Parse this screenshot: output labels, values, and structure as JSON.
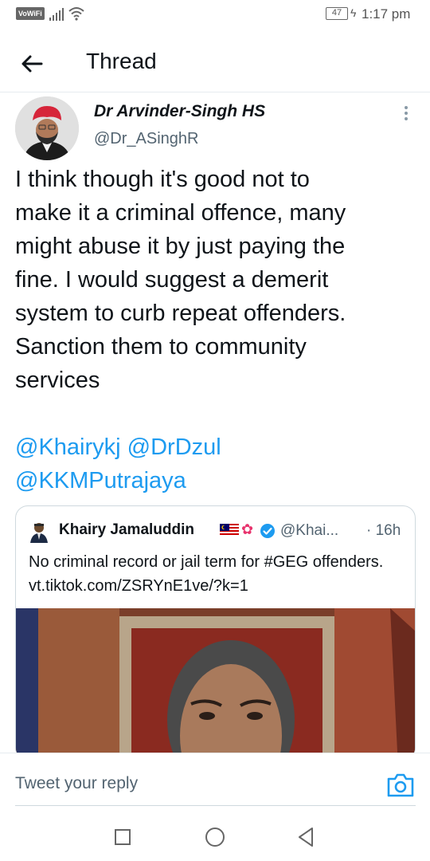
{
  "status_bar": {
    "vowifi": "VoWiFi",
    "battery": "47",
    "time": "1:17 pm"
  },
  "header": {
    "back_icon": "arrow-left-icon",
    "title": "Thread"
  },
  "tweet": {
    "author_name": "Dr Arvinder-Singh HS",
    "author_handle": "@Dr_ASinghR",
    "body": "I think though it's good not to\nmake it a criminal offence, many\nmight abuse it by just paying the\nfine. I would suggest a demerit\nsystem to curb repeat offenders.\nSanction them to community\nservices",
    "mentions": [
      "@Khairykj",
      "@DrDzul",
      "@KKMPutrajaya"
    ]
  },
  "quote": {
    "name": "Khairy Jamaluddin",
    "handle": "@Khai...",
    "time": "· 16h",
    "text": "No criminal record or jail term for #GEG offenders. vt.tiktok.com/ZSRYnE1ve/?k=1"
  },
  "reply": {
    "placeholder": "Tweet your reply"
  },
  "colors": {
    "accent": "#1d9bf0",
    "text": "#0f1419",
    "secondary": "#536471"
  }
}
